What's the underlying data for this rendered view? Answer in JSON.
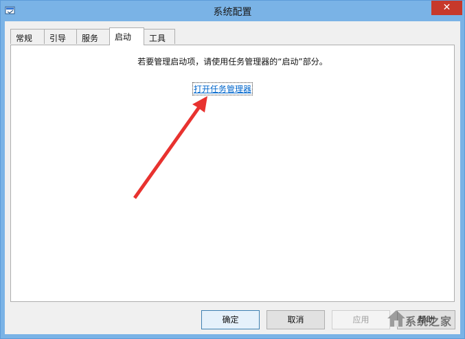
{
  "window": {
    "title": "系统配置",
    "close_glyph": "✕",
    "icon": "msconfig-icon"
  },
  "tabs": [
    {
      "label": "常规",
      "active": false
    },
    {
      "label": "引导",
      "active": false
    },
    {
      "label": "服务",
      "active": false
    },
    {
      "label": "启动",
      "active": true
    },
    {
      "label": "工具",
      "active": false
    }
  ],
  "startup_panel": {
    "message": "若要管理启动项，请使用任务管理器的“启动”部分。",
    "link_text": "打开任务管理器"
  },
  "buttons": {
    "ok": "确定",
    "cancel": "取消",
    "apply": "应用",
    "help": "帮助"
  },
  "annotation": {
    "arrow_color": "#e8322f"
  },
  "watermark": {
    "text": "系统之家"
  },
  "colors": {
    "titlebar": "#7ab3e6",
    "close_button": "#c7392b",
    "link": "#0066cc"
  }
}
